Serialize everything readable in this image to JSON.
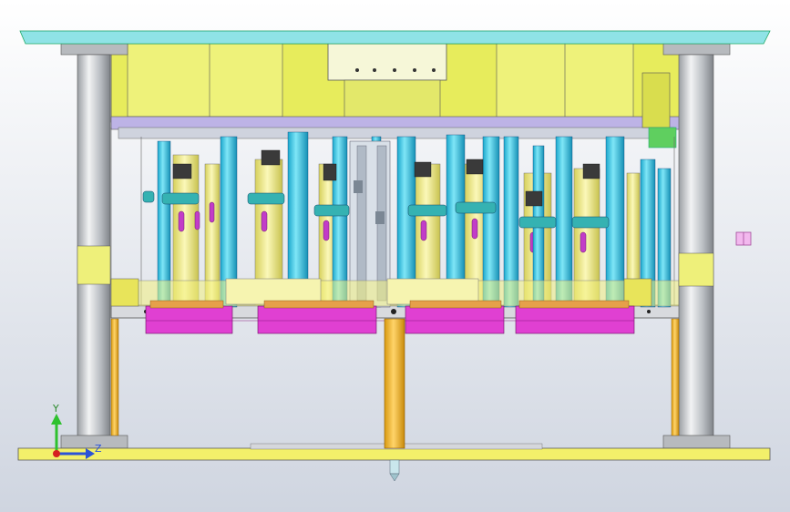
{
  "viewport": {
    "background_top": "#ffffff",
    "background_bottom": "#cfd5e0"
  },
  "colors": {
    "plate_cyan": "#8fe3e6",
    "plate_yellow": "#f3f06a",
    "body_yellow": "#e7ec5c",
    "pillar_gray": "#c9ccd0",
    "pin_cyan": "#2fc7e8",
    "pin_yellow": "#f5f19a",
    "magenta": "#e23fd2",
    "sprue_orange": "#f3b62a",
    "teal": "#2a9a9a",
    "green": "#35b535",
    "lavender": "#b9a9e0"
  },
  "triad": {
    "axis_y": "Y",
    "axis_z": "Z",
    "y_color": "#2ec12e",
    "z_color": "#2a52d8",
    "x_color": "#d62020"
  }
}
